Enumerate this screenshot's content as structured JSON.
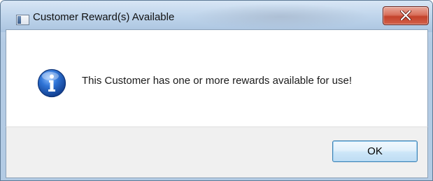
{
  "window": {
    "title": "Customer Reward(s) Available",
    "app_icon": "application-window-icon",
    "close_icon": "close-x-icon"
  },
  "dialog": {
    "icon": "information-icon",
    "message": "This Customer has one or more rewards available for use!",
    "ok_label": "OK"
  },
  "colors": {
    "close_button": "#c4422b",
    "info_icon": "#1f5fbf",
    "ok_border": "#3c7fb1"
  }
}
